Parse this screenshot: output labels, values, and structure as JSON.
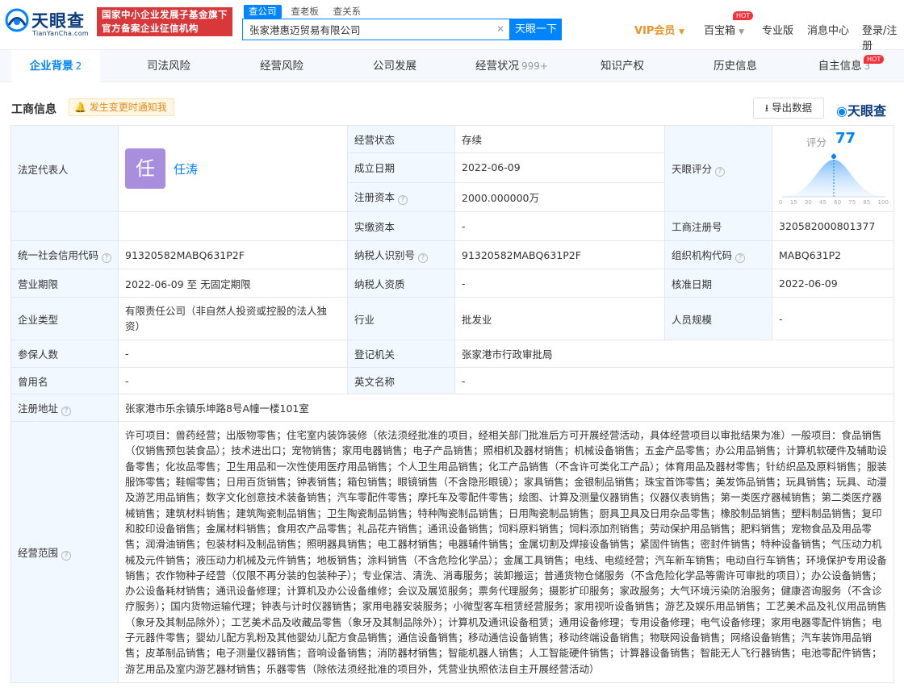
{
  "header": {
    "logo_text": "天眼查",
    "logo_sub": "TianYanCha.com",
    "gov_line1": "国家中小企业发展子基金旗下",
    "gov_line2": "官方备案企业征信机构",
    "search_tabs": [
      "查公司",
      "查老板",
      "查关系"
    ],
    "search_value": "张家港惠迈贸易有限公司",
    "search_button": "天眼一下",
    "vip": "VIP会员",
    "baibox": "百宝箱",
    "hot": "HOT",
    "pro": "专业版",
    "messages": "消息中心",
    "login": "登录/注册"
  },
  "tabs": [
    {
      "label": "企业背景",
      "count": "2"
    },
    {
      "label": "司法风险",
      "count": ""
    },
    {
      "label": "经营风险",
      "count": ""
    },
    {
      "label": "公司发展",
      "count": ""
    },
    {
      "label": "经营状况",
      "count": "999+"
    },
    {
      "label": "知识产权",
      "count": ""
    },
    {
      "label": "历史信息",
      "count": ""
    },
    {
      "label": "自主信息",
      "count": "3"
    }
  ],
  "section": {
    "title": "工商信息",
    "notify": "发生变更时通知我",
    "export": "导出数据",
    "brand": "天眼查"
  },
  "info": {
    "legal_rep_label": "法定代表人",
    "legal_rep_avatar": "任",
    "legal_rep_name": "任涛",
    "status_label": "经营状态",
    "status_value": "存续",
    "established_label": "成立日期",
    "established_value": "2022-06-09",
    "reg_capital_label": "注册资本",
    "reg_capital_value": "2000.000000万",
    "paid_capital_label": "实缴资本",
    "paid_capital_value": "-",
    "score_label": "天眼评分",
    "score_text": "评分",
    "score_value": "77",
    "score_ticks": [
      "0",
      "15",
      "30",
      "45",
      "60",
      "75",
      "85",
      "100"
    ],
    "reg_no_label": "工商注册号",
    "reg_no_value": "320582000801377",
    "credit_code_label": "统一社会信用代码",
    "credit_code_value": "91320582MABQ631P2F",
    "tax_id_label": "纳税人识别号",
    "tax_id_value": "91320582MABQ631P2F",
    "org_code_label": "组织机构代码",
    "org_code_value": "MABQ631P2",
    "term_label": "营业期限",
    "term_value": "2022-06-09 至 无固定期限",
    "taxpayer_label": "纳税人资质",
    "taxpayer_value": "-",
    "approval_label": "核准日期",
    "approval_value": "2022-06-09",
    "type_label": "企业类型",
    "type_value": "有限责任公司（非自然人投资或控股的法人独资）",
    "industry_label": "行业",
    "industry_value": "批发业",
    "staff_label": "人员规模",
    "staff_value": "-",
    "insured_label": "参保人数",
    "insured_value": "-",
    "authority_label": "登记机关",
    "authority_value": "张家港市行政审批局",
    "former_label": "曾用名",
    "former_value": "-",
    "english_label": "英文名称",
    "english_value": "-",
    "address_label": "注册地址",
    "address_value": "张家港市乐余镇乐坤路8号A幢一楼101室",
    "scope_label": "经营范围",
    "scope_value": "许可项目：兽药经营；出版物零售；住宅室内装饰装修（依法须经批准的项目，经相关部门批准后方可开展经营活动，具体经营项目以审批结果为准）一般项目：食品销售（仅销售预包装食品）；技术进出口；宠物销售；家用电器销售；电子产品销售；照相机及器材销售；机械设备销售；五金产品零售；办公用品销售；计算机软硬件及辅助设备零售；化妆品零售；卫生用品和一次性使用医疗用品销售；个人卫生用品销售；化工产品销售（不含许可类化工产品）；体育用品及器材零售；针纺织品及原料销售；服装服饰零售；鞋帽零售；日用百货销售；钟表销售；箱包销售；眼镜销售（不含隐形眼镜）；家具销售；金银制品销售；珠宝首饰零售；美发饰品销售；玩具销售；玩具、动漫及游艺用品销售；数字文化创意技术装备销售；汽车零配件零售；摩托车及零配件零售；绘图、计算及测量仪器销售；仪器仪表销售；第一类医疗器械销售；第二类医疗器械销售；建筑材料销售；建筑陶瓷制品销售；卫生陶瓷制品销售；特种陶瓷制品销售；日用陶瓷制品销售；厨具卫具及日用杂品零售；橡胶制品销售；塑料制品销售；复印和胶印设备销售；金属材料销售；食用农产品零售；礼品花卉销售；通讯设备销售；饲料原料销售；饲料添加剂销售；劳动保护用品销售；肥料销售；宠物食品及用品零售；润滑油销售；包装材料及制品销售；照明器具销售；电工器材销售；电器辅件销售；金属切割及焊接设备销售；紧固件销售；密封件销售；特种设备销售；气压动力机械及元件销售；液压动力机械及元件销售；地板销售；涂料销售（不含危险化学品）；金属工具销售；电线、电缆经营；汽车新车销售；电动自行车销售；环境保护专用设备销售；农作物种子经营（仅限不再分装的包装种子）；专业保洁、清洗、消毒服务；装卸搬运；普通货物仓储服务（不含危险化学品等需许可审批的项目）；办公设备销售；办公设备耗材销售；通讯设备修理；计算机及办公设备维修；会议及展览服务；票务代理服务；摄影扩印服务；家政服务；大气环境污染防治服务；健康咨询服务（不含诊疗服务）；国内货物运输代理；钟表与计时仪器销售；家用电器安装服务；小微型客车租赁经营服务；家用视听设备销售；游艺及娱乐用品销售；工艺美术品及礼仪用品销售（象牙及其制品除外）；工艺美术品及收藏品零售（象牙及其制品除外）；计算机及通讯设备租赁；通用设备修理；专用设备修理；电气设备修理；家用电器零配件销售；电子元器件零售；婴幼儿配方乳粉及其他婴幼儿配方食品销售；通信设备销售；移动通信设备销售；移动终端设备销售；物联网设备销售；网络设备销售；汽车装饰用品销售；皮革制品销售；电子测量仪器销售；音响设备销售；消防器材销售；智能机器人销售；人工智能硬件销售；计算器设备销售；智能无人飞行器销售；电池零配件销售；游艺用品及室内游艺器材销售；乐器零售（除依法须经批准的项目外，凭营业执照依法自主开展经营活动）"
  },
  "colors": {
    "primary": "#0084ff",
    "brand_navy": "#0a3c7e",
    "gov_red": "#d9383a",
    "label_bg": "#f2f8ff",
    "vip_orange": "#e8952b"
  }
}
